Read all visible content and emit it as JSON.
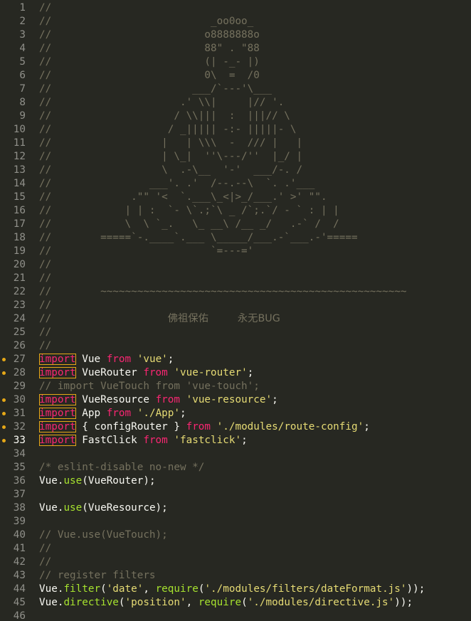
{
  "editor": {
    "lines": [
      {
        "n": "1",
        "tokens": [
          {
            "t": "//",
            "c": "comment"
          }
        ]
      },
      {
        "n": "2",
        "tokens": [
          {
            "t": "//                          _oo0oo_",
            "c": "comment"
          }
        ]
      },
      {
        "n": "3",
        "tokens": [
          {
            "t": "//                         o8888888o",
            "c": "comment"
          }
        ]
      },
      {
        "n": "4",
        "tokens": [
          {
            "t": "//                         88\" . \"88",
            "c": "comment"
          }
        ]
      },
      {
        "n": "5",
        "tokens": [
          {
            "t": "//                         (| -_- |)",
            "c": "comment"
          }
        ]
      },
      {
        "n": "6",
        "tokens": [
          {
            "t": "//                         0\\  =  /0",
            "c": "comment"
          }
        ]
      },
      {
        "n": "7",
        "tokens": [
          {
            "t": "//                       ___/`---'\\___",
            "c": "comment"
          }
        ]
      },
      {
        "n": "8",
        "tokens": [
          {
            "t": "//                     .' \\\\|     |// '.",
            "c": "comment"
          }
        ]
      },
      {
        "n": "9",
        "tokens": [
          {
            "t": "//                    / \\\\|||  :  |||// \\",
            "c": "comment"
          }
        ]
      },
      {
        "n": "10",
        "tokens": [
          {
            "t": "//                   / _||||| -:- |||||- \\",
            "c": "comment"
          }
        ]
      },
      {
        "n": "11",
        "tokens": [
          {
            "t": "//                  |   | \\\\\\  -  /// |   |",
            "c": "comment"
          }
        ]
      },
      {
        "n": "12",
        "tokens": [
          {
            "t": "//                  | \\_|  ''\\---/''  |_/ |",
            "c": "comment"
          }
        ]
      },
      {
        "n": "13",
        "tokens": [
          {
            "t": "//                  \\  .-\\__  '-'  ___/-. /",
            "c": "comment"
          }
        ]
      },
      {
        "n": "14",
        "tokens": [
          {
            "t": "//                ___'. .'  /--.--\\  `. .'___",
            "c": "comment"
          }
        ]
      },
      {
        "n": "15",
        "tokens": [
          {
            "t": "//             .\"\" '<  `.___\\_<|>_/___.' >' \"\".",
            "c": "comment"
          }
        ]
      },
      {
        "n": "16",
        "tokens": [
          {
            "t": "//            | | :  `- \\`.;`\\ _ /`;.`/ - ` : | |",
            "c": "comment"
          }
        ]
      },
      {
        "n": "17",
        "tokens": [
          {
            "t": "//            \\  \\ `_.   \\_ __\\ /__ _/   .-` /  /",
            "c": "comment"
          }
        ]
      },
      {
        "n": "18",
        "tokens": [
          {
            "t": "//        =====`-.____`.___ \\_____/___.-`___.-'=====",
            "c": "comment"
          }
        ]
      },
      {
        "n": "19",
        "tokens": [
          {
            "t": "//                          `=---='",
            "c": "comment"
          }
        ]
      },
      {
        "n": "20",
        "tokens": [
          {
            "t": "//",
            "c": "comment"
          }
        ]
      },
      {
        "n": "21",
        "tokens": [
          {
            "t": "//",
            "c": "comment"
          }
        ]
      },
      {
        "n": "22",
        "tokens": [
          {
            "t": "//        ~~~~~~~~~~~~~~~~~~~~~~~~~~~~~~~~~~~~~~~~~~~~~~~~~~",
            "c": "comment"
          }
        ]
      },
      {
        "n": "23",
        "tokens": [
          {
            "t": "//",
            "c": "comment"
          }
        ]
      },
      {
        "n": "24",
        "tokens": [
          {
            "t": "//                   ",
            "c": "comment"
          },
          {
            "t": "佛祖保佑         永无BUG",
            "c": "comment cjk"
          }
        ]
      },
      {
        "n": "25",
        "tokens": [
          {
            "t": "//",
            "c": "comment"
          }
        ]
      },
      {
        "n": "26",
        "tokens": [
          {
            "t": "//",
            "c": "comment"
          }
        ]
      },
      {
        "n": "27",
        "mark": true,
        "tokens": [
          {
            "t": "import",
            "c": "kwbox"
          },
          {
            "t": " Vue ",
            "c": "plain"
          },
          {
            "t": "from",
            "c": "kw"
          },
          {
            "t": " ",
            "c": "plain"
          },
          {
            "t": "'vue'",
            "c": "str"
          },
          {
            "t": ";",
            "c": "plain"
          }
        ]
      },
      {
        "n": "28",
        "mark": true,
        "tokens": [
          {
            "t": "import",
            "c": "kwbox"
          },
          {
            "t": " VueRouter ",
            "c": "plain"
          },
          {
            "t": "from",
            "c": "kw"
          },
          {
            "t": " ",
            "c": "plain"
          },
          {
            "t": "'vue-router'",
            "c": "str"
          },
          {
            "t": ";",
            "c": "plain"
          }
        ]
      },
      {
        "n": "29",
        "tokens": [
          {
            "t": "// import VueTouch from 'vue-touch';",
            "c": "comment"
          }
        ]
      },
      {
        "n": "30",
        "mark": true,
        "tokens": [
          {
            "t": "import",
            "c": "kwbox"
          },
          {
            "t": " VueResource ",
            "c": "plain"
          },
          {
            "t": "from",
            "c": "kw"
          },
          {
            "t": " ",
            "c": "plain"
          },
          {
            "t": "'vue-resource'",
            "c": "str"
          },
          {
            "t": ";",
            "c": "plain"
          }
        ]
      },
      {
        "n": "31",
        "mark": true,
        "tokens": [
          {
            "t": "import",
            "c": "kwbox"
          },
          {
            "t": " App ",
            "c": "plain"
          },
          {
            "t": "from",
            "c": "kw"
          },
          {
            "t": " ",
            "c": "plain"
          },
          {
            "t": "'./App'",
            "c": "str"
          },
          {
            "t": ";",
            "c": "plain"
          }
        ]
      },
      {
        "n": "32",
        "mark": true,
        "tokens": [
          {
            "t": "import",
            "c": "kwbox"
          },
          {
            "t": " { configRouter } ",
            "c": "plain"
          },
          {
            "t": "from",
            "c": "kw"
          },
          {
            "t": " ",
            "c": "plain"
          },
          {
            "t": "'./modules/route-config'",
            "c": "str"
          },
          {
            "t": ";",
            "c": "plain"
          }
        ]
      },
      {
        "n": "33",
        "mark": true,
        "active": true,
        "tokens": [
          {
            "t": "import",
            "c": "kwbox"
          },
          {
            "t": " FastClick ",
            "c": "plain"
          },
          {
            "t": "from",
            "c": "kw"
          },
          {
            "t": " ",
            "c": "plain"
          },
          {
            "t": "'fastclick'",
            "c": "str"
          },
          {
            "t": ";",
            "c": "plain"
          }
        ]
      },
      {
        "n": "34",
        "tokens": []
      },
      {
        "n": "35",
        "tokens": [
          {
            "t": "/* eslint-disable no-new */",
            "c": "comment"
          }
        ]
      },
      {
        "n": "36",
        "tokens": [
          {
            "t": "Vue.",
            "c": "plain"
          },
          {
            "t": "use",
            "c": "fn"
          },
          {
            "t": "(VueRouter);",
            "c": "plain"
          }
        ]
      },
      {
        "n": "37",
        "tokens": []
      },
      {
        "n": "38",
        "tokens": [
          {
            "t": "Vue.",
            "c": "plain"
          },
          {
            "t": "use",
            "c": "fn"
          },
          {
            "t": "(VueResource);",
            "c": "plain"
          }
        ]
      },
      {
        "n": "39",
        "tokens": []
      },
      {
        "n": "40",
        "tokens": [
          {
            "t": "// Vue.use(VueTouch);",
            "c": "comment"
          }
        ]
      },
      {
        "n": "41",
        "tokens": [
          {
            "t": "//",
            "c": "comment"
          }
        ]
      },
      {
        "n": "42",
        "tokens": [
          {
            "t": "//",
            "c": "comment"
          }
        ]
      },
      {
        "n": "43",
        "tokens": [
          {
            "t": "// register filters",
            "c": "comment"
          }
        ]
      },
      {
        "n": "44",
        "tokens": [
          {
            "t": "Vue.",
            "c": "plain"
          },
          {
            "t": "filter",
            "c": "fn"
          },
          {
            "t": "(",
            "c": "plain"
          },
          {
            "t": "'date'",
            "c": "str"
          },
          {
            "t": ", ",
            "c": "plain"
          },
          {
            "t": "require",
            "c": "fn"
          },
          {
            "t": "(",
            "c": "plain"
          },
          {
            "t": "'./modules/filters/dateFormat.js'",
            "c": "str"
          },
          {
            "t": "));",
            "c": "plain"
          }
        ]
      },
      {
        "n": "45",
        "tokens": [
          {
            "t": "Vue.",
            "c": "plain"
          },
          {
            "t": "directive",
            "c": "fn"
          },
          {
            "t": "(",
            "c": "plain"
          },
          {
            "t": "'position'",
            "c": "str"
          },
          {
            "t": ", ",
            "c": "plain"
          },
          {
            "t": "require",
            "c": "fn"
          },
          {
            "t": "(",
            "c": "plain"
          },
          {
            "t": "'./modules/directive.js'",
            "c": "str"
          },
          {
            "t": "));",
            "c": "plain"
          }
        ]
      },
      {
        "n": "46",
        "tokens": []
      }
    ]
  }
}
